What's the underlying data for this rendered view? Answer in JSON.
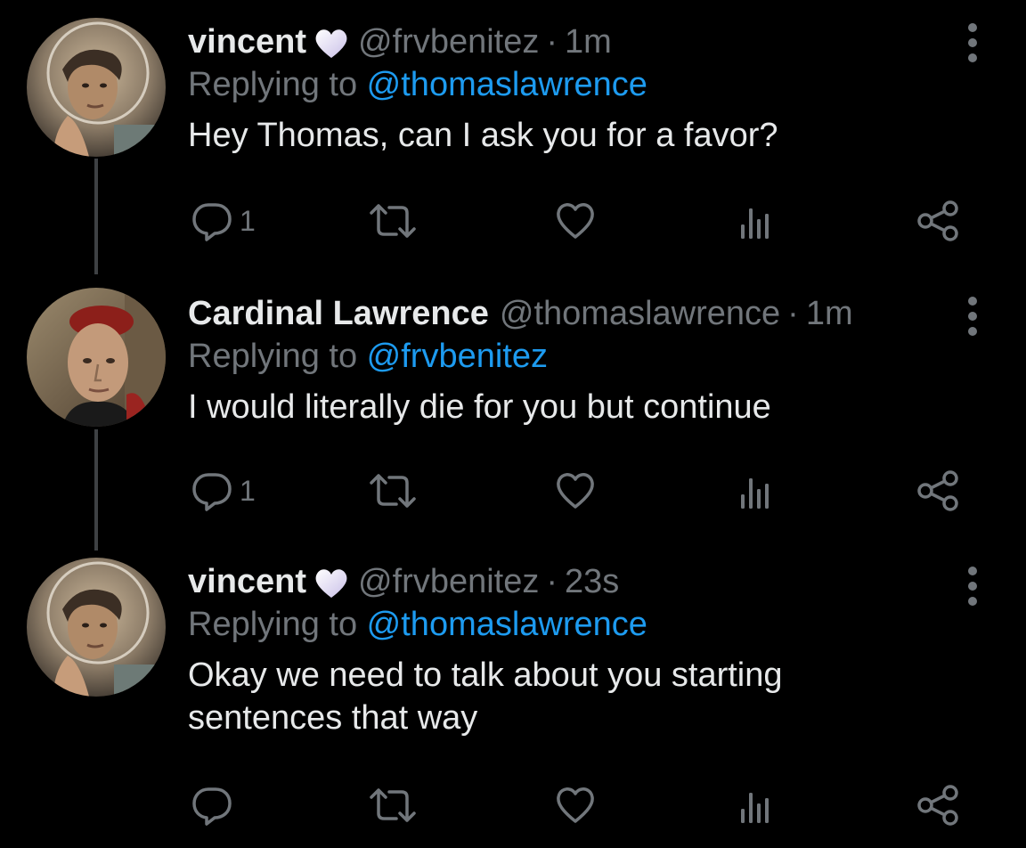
{
  "thread": [
    {
      "display_name": "vincent",
      "handle": "@frvbenitez",
      "separator": "·",
      "time": "1m",
      "reply_prefix": "Replying to ",
      "reply_to": "@thomaslawrence",
      "text": "Hey Thomas, can I ask you for a favor?",
      "reply_count": "1",
      "has_heart_badge": true,
      "avatar": "vincent-avatar"
    },
    {
      "display_name": "Cardinal Lawrence",
      "handle": "@thomaslawrence",
      "separator": "·",
      "time": "1m",
      "reply_prefix": "Replying to ",
      "reply_to": "@frvbenitez",
      "text": "I would literally die for you but continue",
      "reply_count": "1",
      "has_heart_badge": false,
      "avatar": "cardinal-avatar"
    },
    {
      "display_name": "vincent",
      "handle": "@frvbenitez",
      "separator": "·",
      "time": "23s",
      "reply_prefix": "Replying to ",
      "reply_to": "@thomaslawrence",
      "text": "Okay we need to talk about you starting sentences that way",
      "reply_count": "",
      "has_heart_badge": true,
      "avatar": "vincent-avatar"
    }
  ],
  "icons": {
    "reply": "reply-icon",
    "retweet": "retweet-icon",
    "like": "heart-icon",
    "views": "views-icon",
    "share": "share-icon",
    "more": "more-options-icon",
    "badge": "white-heart-icon"
  },
  "colors": {
    "background": "#000000",
    "text_primary": "#e7e9ea",
    "text_secondary": "#71767b",
    "link": "#1d9bf0",
    "thread_line": "#3e4144"
  }
}
